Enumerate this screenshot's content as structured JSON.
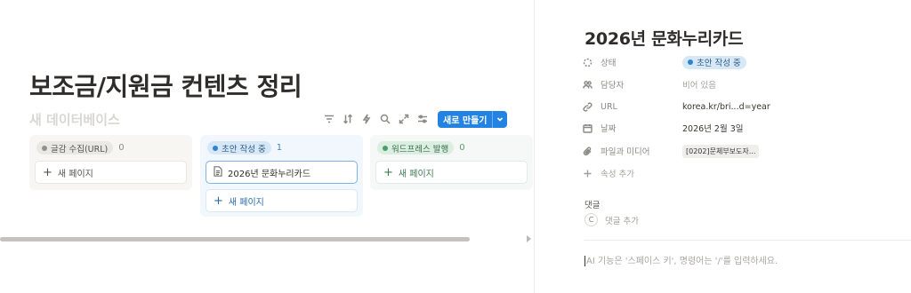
{
  "board": {
    "page_title": "보조금/지원금 컨텐츠 정리",
    "database_name": "새 데이터베이스",
    "toolbar": {
      "icons": [
        "filter-icon",
        "sort-icon",
        "lightning-icon",
        "search-icon",
        "expand-icon",
        "settings-icon"
      ],
      "new_button_label": "새로 만들기"
    },
    "columns": [
      {
        "status": "글감 수집(URL)",
        "count": "0",
        "color": "#91918e",
        "cards": [],
        "add_label": "새 페이지"
      },
      {
        "status": "초안 작성 중",
        "count": "1",
        "color": "#2e83d0",
        "cards": [
          "2026년 문화누리카드"
        ],
        "add_label": "새 페이지"
      },
      {
        "status": "워드프레스 발행",
        "count": "0",
        "color": "#4d9c6b",
        "cards": [],
        "add_label": "새 페이지"
      }
    ]
  },
  "peek": {
    "title": "2026년 문화누리카드",
    "properties": {
      "status": {
        "label": "상태",
        "value": "초안 작성 중"
      },
      "assignee": {
        "label": "담당자",
        "value": "비어 있음"
      },
      "url": {
        "label": "URL",
        "value": "korea.kr/bri...d=year"
      },
      "date": {
        "label": "날짜",
        "value": "2026년 2월 3일"
      },
      "files": {
        "label": "파일과 미디어",
        "value": "[0202]문체부보도자..."
      },
      "add_property": "속성 추가"
    },
    "comments": {
      "heading": "댓글",
      "avatar_letter": "C",
      "add_label": "댓글 추가"
    },
    "ai_hint": "AI 기능은 '스페이스 키', 명령어는 '/'를 입력하세요."
  },
  "colors": {
    "accent": "#2383e2",
    "selected_card_border": "#7fb2e5"
  }
}
